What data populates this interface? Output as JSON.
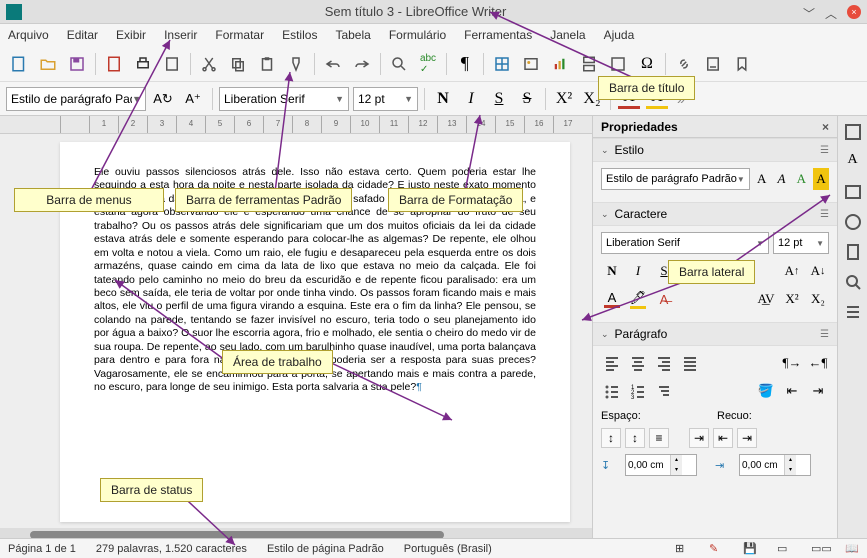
{
  "titlebar": {
    "title": "Sem título 3 - LibreOffice Writer"
  },
  "menubar": [
    "Arquivo",
    "Editar",
    "Exibir",
    "Inserir",
    "Formatar",
    "Estilos",
    "Tabela",
    "Formulário",
    "Ferramentas",
    "Janela",
    "Ajuda"
  ],
  "formatting": {
    "para_style": "Estilo de parágrafo Padrão",
    "font_name": "Liberation Serif",
    "font_size": "12 pt",
    "btn_bold": "N",
    "btn_italic": "I",
    "btn_underline": "S",
    "btn_strike": "S",
    "btn_super": "X²",
    "btn_sub": "X₂"
  },
  "ruler_ticks": [
    "2",
    "1",
    "",
    "1",
    "2",
    "3",
    "4",
    "5",
    "6",
    "7",
    "8",
    "9",
    "10",
    "11",
    "12",
    "13",
    "14",
    "15",
    "16",
    "17"
  ],
  "document_text": "Ele ouviu passos silenciosos atrás dele. Isso não estava certo. Quem poderia estar lhe seguindo a esta hora da noite e nesta parte isolada da cidade? E justo neste exato momento em que ele iria dar o seu grande golpe. Haveria outro safado que teria tido a mesma ideia, e estaria agora observando ele e esperando uma chance de se apropriar do fruto de seu trabalho? Ou os passos atrás dele significariam que um dos muitos oficiais da lei da cidade estava atrás dele e somente esperando para colocar-lhe as algemas? De repente, ele olhou em volta e notou a viela. Como um raio, ele fugiu e desapareceu pela esquerda entre os dois armazéns, quase caindo em cima da lata de lixo que estava no meio da calçada. Ele foi tateando pelo caminho no meio do breu da escuridão e de repente ficou paralisado: era um beco sem saída, ele teria de voltar por onde tinha vindo. Os passos foram ficando mais e mais altos, ele viu o perfil de uma figura virando a esquina. Este era o fim da linha? Ele pensou, se colando na parede, tentando se fazer invisível no escuro, teria todo o seu planejamento ido por água a baixo? O suor lhe escorria agora, frio e molhado, ele sentia o cheiro do medo vir de sua roupa. De repente, ao seu lado, com um barulhinho quase inaudível, uma porta balançava para dentro e para fora na brisa da noite. Esta poderia ser a resposta para suas preces? Vagarosamente, ele se encaminhou para a porta, se apertando mais e mais contra a parede, no escuro, para longe de seu inimigo. Esta porta salvaria a sua pele?",
  "sidebar": {
    "title": "Propriedades",
    "style": {
      "title": "Estilo",
      "value": "Estilo de parágrafo Padrão"
    },
    "char": {
      "title": "Caractere",
      "font": "Liberation Serif",
      "size": "12 pt",
      "bold": "N",
      "italic": "I",
      "under": "S",
      "strike": "S",
      "shadow": "A",
      "sup": "Aᵗ",
      "sub": "Aᵥ",
      "color": "A",
      "hilite": "A",
      "spacing": "AV",
      "kern": "AV",
      "x2": "X²",
      "x2b": "X²"
    },
    "para": {
      "title": "Parágrafo",
      "spacing_label": "Espaço:",
      "indent_label": "Recuo:",
      "spacing_value": "0,00 cm",
      "indent_value": "0,00 cm"
    }
  },
  "statusbar": {
    "page": "Página 1 de 1",
    "words": "279 palavras, 1.520 caracteres",
    "page_style": "Estilo de página Padrão",
    "lang": "Português (Brasil)"
  },
  "callouts": {
    "title": "Barra de título",
    "menus": "Barra de menus",
    "tools": "Barra de ferramentas Padrão",
    "format": "Barra de Formatação",
    "side": "Barra lateral",
    "work": "Área de trabalho",
    "status": "Barra de status"
  }
}
